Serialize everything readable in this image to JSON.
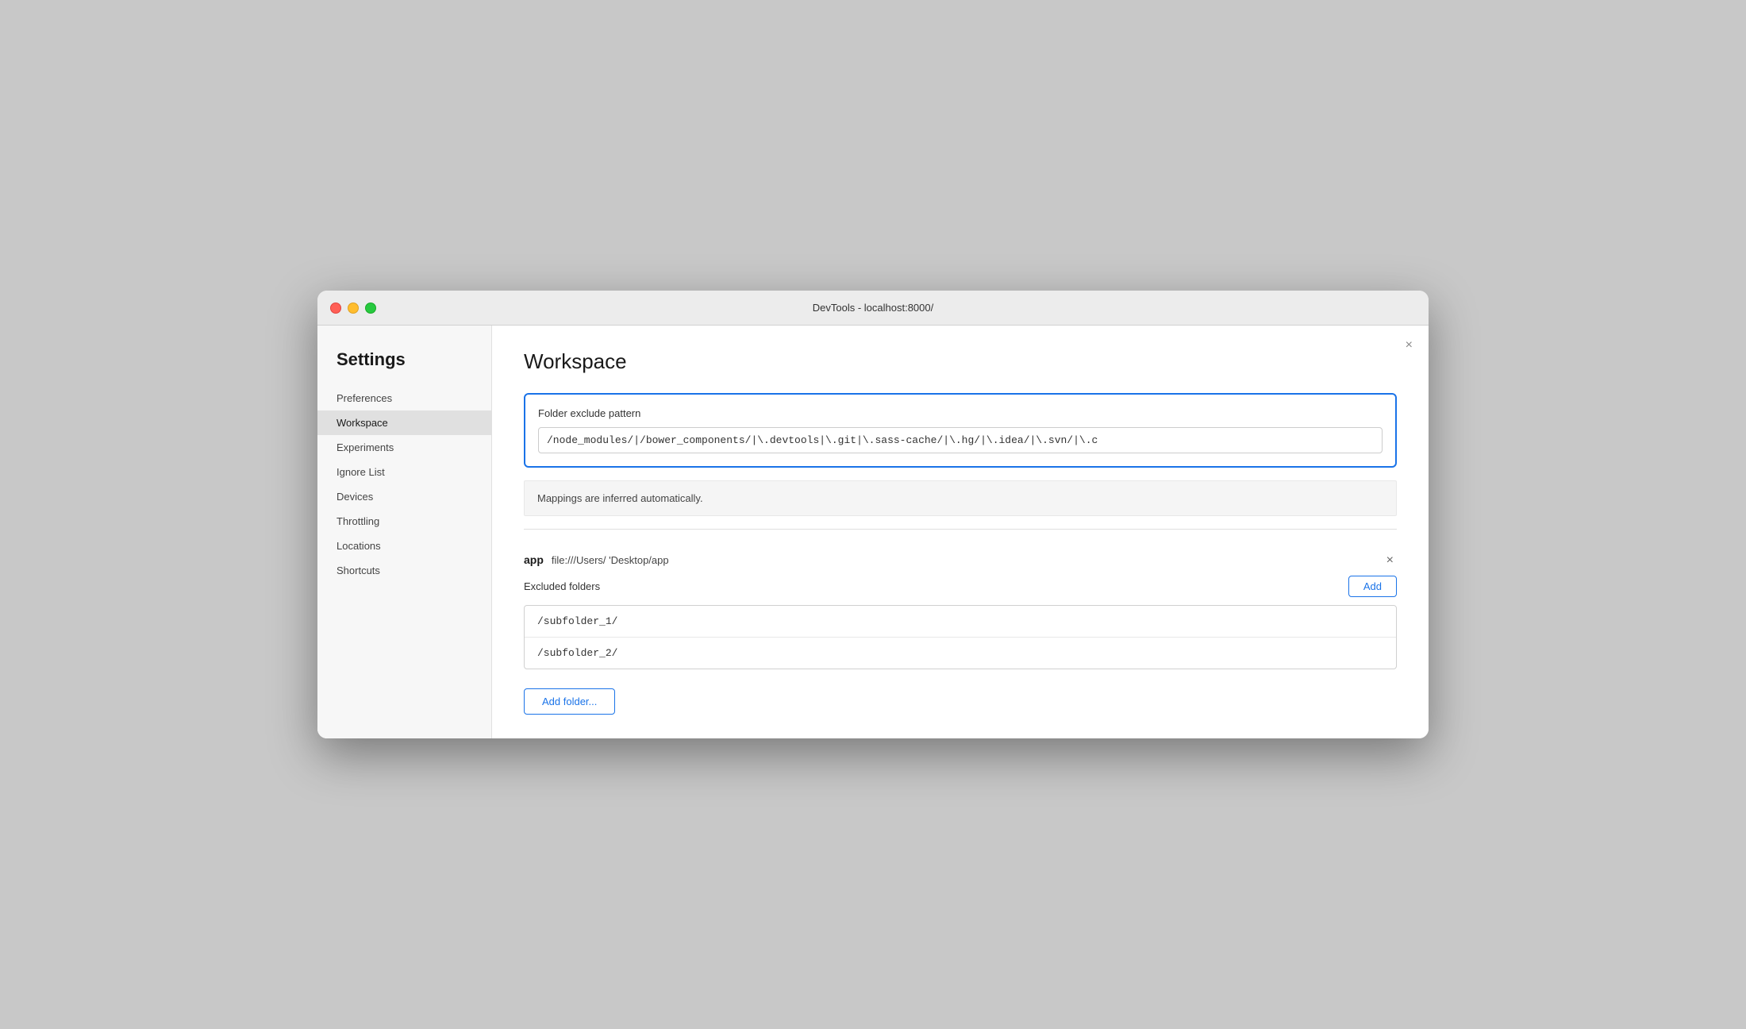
{
  "window": {
    "title": "DevTools - localhost:8000/"
  },
  "titlebar": {
    "close_label": "×"
  },
  "sidebar": {
    "heading": "Settings",
    "items": [
      {
        "id": "preferences",
        "label": "Preferences",
        "active": false
      },
      {
        "id": "workspace",
        "label": "Workspace",
        "active": true
      },
      {
        "id": "experiments",
        "label": "Experiments",
        "active": false
      },
      {
        "id": "ignore-list",
        "label": "Ignore List",
        "active": false
      },
      {
        "id": "devices",
        "label": "Devices",
        "active": false
      },
      {
        "id": "throttling",
        "label": "Throttling",
        "active": false
      },
      {
        "id": "locations",
        "label": "Locations",
        "active": false
      },
      {
        "id": "shortcuts",
        "label": "Shortcuts",
        "active": false
      }
    ]
  },
  "main": {
    "page_title": "Workspace",
    "folder_exclude": {
      "label": "Folder exclude pattern",
      "value": "/node_modules/|/bower_components/|\\.devtools|\\.git|\\.sass-cache/|\\.hg/|\\.idea/|\\.svn/|\\.c"
    },
    "mappings_text": "Mappings are inferred automatically.",
    "workspace_entry": {
      "name": "app",
      "path": "file:///Users/      'Desktop/app"
    },
    "excluded_folders_label": "Excluded folders",
    "add_button_label": "Add",
    "excluded_items": [
      "/subfolder_1/",
      "/subfolder_2/"
    ],
    "add_folder_label": "Add folder..."
  },
  "icons": {
    "close": "×",
    "workspace_remove": "×"
  }
}
